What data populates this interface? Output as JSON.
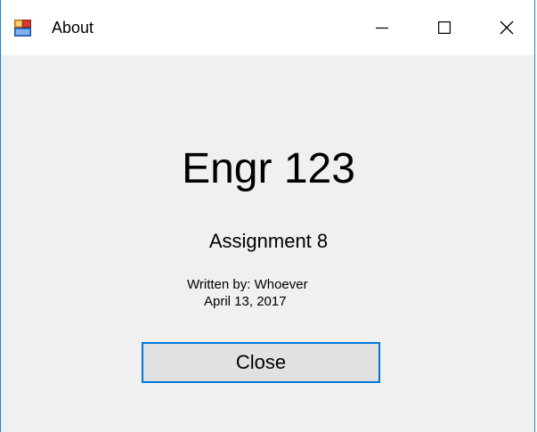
{
  "window": {
    "title": "About",
    "app_icon": "winforms-app-icon",
    "controls": {
      "minimize_icon": "minimize-icon",
      "maximize_icon": "maximize-icon",
      "close_icon": "close-icon"
    }
  },
  "about": {
    "heading": "Engr 123",
    "subheading": "Assignment 8",
    "author": "Written by: Whoever",
    "date": "April 13, 2017"
  },
  "buttons": {
    "close_label": "Close"
  },
  "colors": {
    "window_border": "#1883d7",
    "button_focus_border": "#0078d7",
    "client_background": "#f0f0f0",
    "button_face": "#e1e1e1"
  }
}
